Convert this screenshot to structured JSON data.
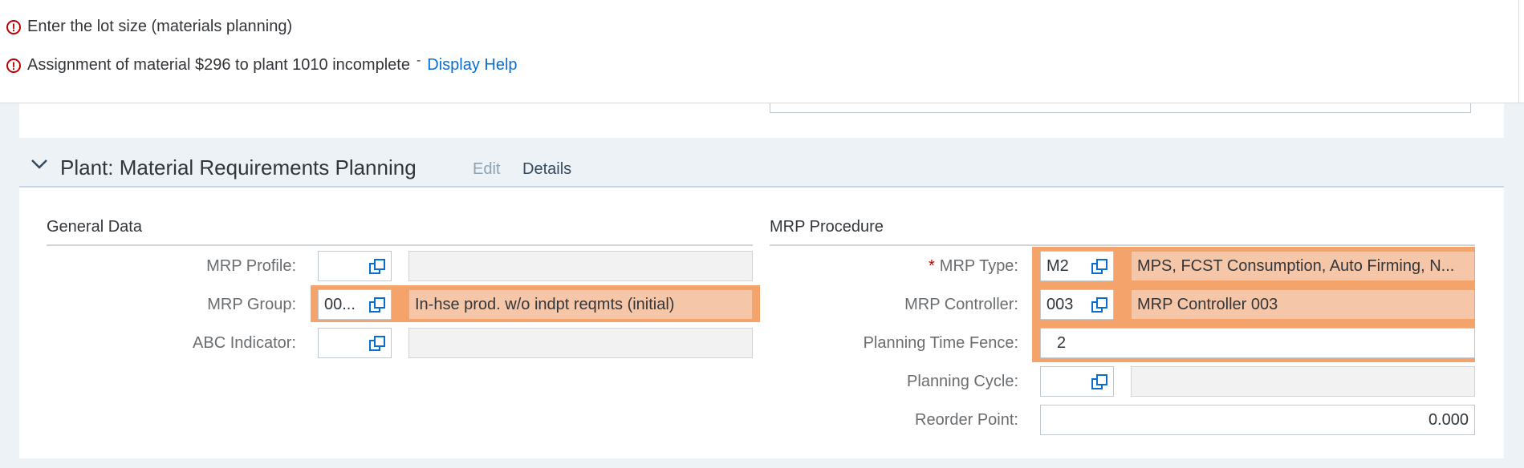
{
  "messages": [
    {
      "text": "Enter the lot size (materials planning)",
      "icon": "error-icon"
    },
    {
      "text": "Assignment of material $296 to plant 1010 incomplete",
      "dash": "-",
      "link": "Display Help",
      "icon": "error-icon"
    }
  ],
  "section": {
    "title": "Plant: Material Requirements Planning",
    "edit_label": "Edit",
    "details_label": "Details"
  },
  "general_data": {
    "title": "General Data",
    "mrp_profile": {
      "label": "MRP Profile:",
      "value": "",
      "description": ""
    },
    "mrp_group": {
      "label": "MRP Group:",
      "value": "00...",
      "description": "In-hse prod. w/o indpt reqmts (initial)"
    },
    "abc_indicator": {
      "label": "ABC Indicator:",
      "value": "",
      "description": ""
    }
  },
  "mrp_procedure": {
    "title": "MRP Procedure",
    "mrp_type": {
      "required": "*",
      "label": "MRP Type:",
      "value": "M2",
      "description": "MPS, FCST Consumption, Auto Firming, N..."
    },
    "mrp_controller": {
      "label": "MRP Controller:",
      "value": "003",
      "description": "MRP Controller 003"
    },
    "planning_time_fence": {
      "label": "Planning Time Fence:",
      "value": "2"
    },
    "planning_cycle": {
      "label": "Planning Cycle:",
      "value": "",
      "description": ""
    },
    "reorder_point": {
      "label": "Reorder Point:",
      "value": "0.000"
    }
  },
  "colors": {
    "error": "#bb0000",
    "link": "#0a6ed1",
    "highlight_outline": "#f4a46a",
    "highlight_fill": "#f6c6a8"
  }
}
